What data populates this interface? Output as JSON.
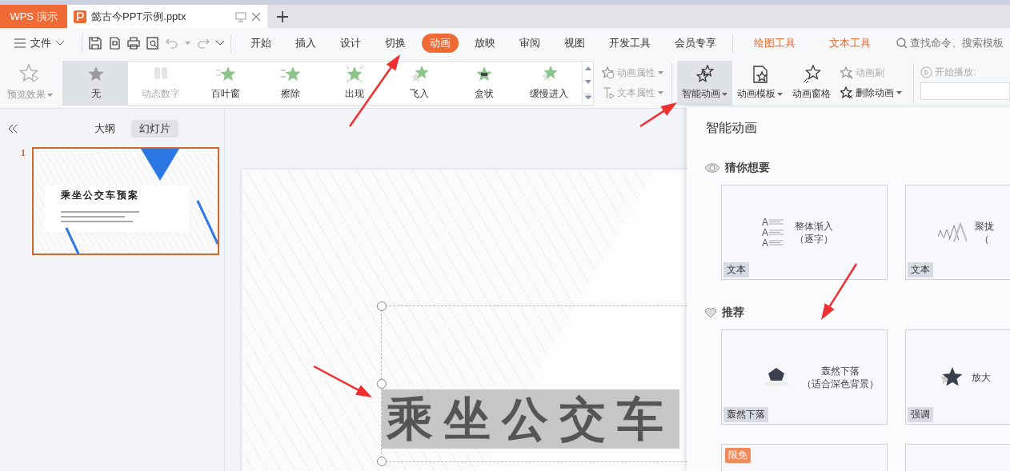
{
  "app_button": {
    "label": "WPS 演示"
  },
  "document_tab": {
    "title": "懿古今PPT示例.pptx",
    "selected": true
  },
  "file_menu": {
    "label": "文件"
  },
  "ribbon_tabs": [
    {
      "label": "开始",
      "selected": false,
      "kind": "main"
    },
    {
      "label": "插入",
      "selected": false,
      "kind": "main"
    },
    {
      "label": "设计",
      "selected": false,
      "kind": "main"
    },
    {
      "label": "切换",
      "selected": false,
      "kind": "main"
    },
    {
      "label": "动画",
      "selected": true,
      "kind": "main"
    },
    {
      "label": "放映",
      "selected": false,
      "kind": "main"
    },
    {
      "label": "审阅",
      "selected": false,
      "kind": "main"
    },
    {
      "label": "视图",
      "selected": false,
      "kind": "main"
    },
    {
      "label": "开发工具",
      "selected": false,
      "kind": "main"
    },
    {
      "label": "会员专享",
      "selected": false,
      "kind": "main"
    },
    {
      "label": "绘图工具",
      "selected": false,
      "kind": "context"
    },
    {
      "label": "文本工具",
      "selected": false,
      "kind": "context"
    }
  ],
  "search": {
    "placeholder": "查找命令、搜索模板"
  },
  "preview_button": {
    "label": "预览效果"
  },
  "effects": [
    {
      "label": "无",
      "kind": "none",
      "selected": true,
      "disabled": false
    },
    {
      "label": "动态数字",
      "kind": "counter",
      "selected": false,
      "disabled": true
    },
    {
      "label": "百叶窗",
      "kind": "blinds",
      "selected": false,
      "disabled": false
    },
    {
      "label": "擦除",
      "kind": "wipe",
      "selected": false,
      "disabled": false
    },
    {
      "label": "出现",
      "kind": "appear",
      "selected": false,
      "disabled": false
    },
    {
      "label": "飞入",
      "kind": "fly",
      "selected": false,
      "disabled": false
    },
    {
      "label": "盒状",
      "kind": "box",
      "selected": false,
      "disabled": false
    },
    {
      "label": "缓慢进入",
      "kind": "ease",
      "selected": false,
      "disabled": false
    }
  ],
  "property_commands": [
    {
      "label": "动画属性",
      "kind": "animation-properties",
      "disabled": true
    },
    {
      "label": "文本属性",
      "kind": "text-properties",
      "disabled": true
    }
  ],
  "large_commands": [
    {
      "label": "智能动画",
      "kind": "smart",
      "selected": true,
      "dropdown": true
    },
    {
      "label": "动画模板",
      "kind": "template",
      "selected": false,
      "dropdown": true
    },
    {
      "label": "动画窗格",
      "kind": "pane",
      "selected": false,
      "dropdown": false
    }
  ],
  "small_commands": [
    {
      "label": "动画刷",
      "kind": "brush",
      "disabled": true,
      "dropdown": false
    },
    {
      "label": "删除动画",
      "kind": "delete",
      "disabled": false,
      "dropdown": true
    }
  ],
  "playback": {
    "label": "开始播放:",
    "disabled": true
  },
  "view_tabs": [
    {
      "label": "大纲",
      "selected": false
    },
    {
      "label": "幻灯片",
      "selected": true
    }
  ],
  "slides": [
    {
      "number": "1",
      "title": "乘坐公交车预案",
      "selected": true
    }
  ],
  "slide_title": "乘坐公交车",
  "smart_panel": {
    "title": "智能动画",
    "sections": [
      {
        "heading": "猜你想要",
        "kind": "guess",
        "cards": [
          {
            "lines": [
              "整体渐入",
              "（逐字）"
            ],
            "kind": "text-lines",
            "glyphs": [
              "A",
              "A",
              "A"
            ],
            "tag": "文本"
          },
          {
            "lines": [
              "聚拢",
              "（"
            ],
            "kind": "text-grow",
            "tag": "文本"
          }
        ]
      },
      {
        "heading": "推荐",
        "kind": "recommend",
        "cards": [
          {
            "lines": [
              "轰然下落",
              "（适合深色背景）"
            ],
            "kind": "drop",
            "tag": "轰然下落"
          },
          {
            "lines": [
              "放大"
            ],
            "kind": "star",
            "tag": "强调"
          },
          {
            "kind": "blank",
            "badge": "限免"
          },
          {
            "kind": "blank"
          }
        ]
      }
    ]
  }
}
